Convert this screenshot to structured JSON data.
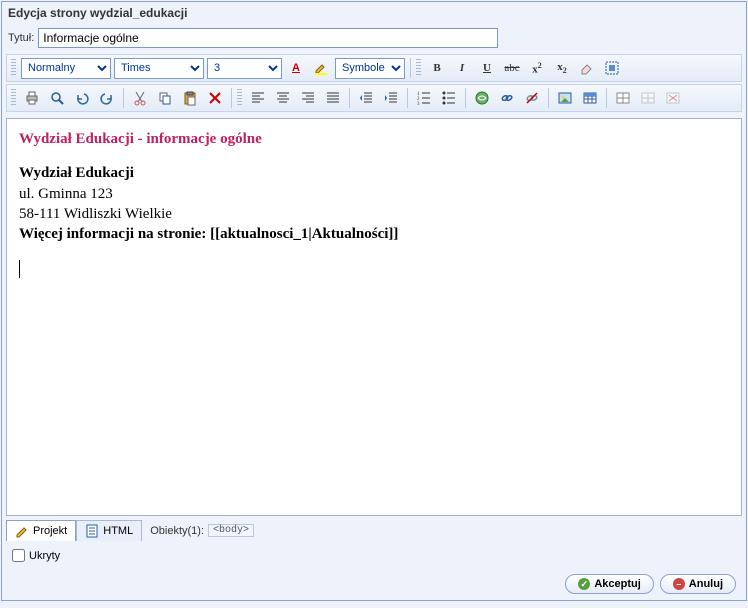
{
  "header": {
    "title": "Edycja strony wydzial_edukacji"
  },
  "titleRow": {
    "label": "Tytuł:",
    "value": "Informacje ogólne"
  },
  "toolbar1": {
    "styleSel": "Normalny",
    "fontSel": "Times",
    "sizeSel": "3",
    "symbolSel": "Symbole",
    "fontColorGlyph": "A",
    "bold": "B",
    "italic": "I",
    "underline": "U",
    "strike": "abc",
    "sup": "x²",
    "sub": "x₂"
  },
  "content": {
    "heading": "Wydział Edukacji - informacje ogólne",
    "line1": "Wydział Edukacji",
    "line2": "ul. Gminna 123",
    "line3": "58-111 Widliszki Wielkie",
    "line4a": "Więcej informacji na stronie: ",
    "line4b": "[[aktualnosci_1|Aktualności]]"
  },
  "tabs": {
    "projekt": "Projekt",
    "html": "HTML",
    "objects": "Obiekty(1):",
    "objToken": "<body>"
  },
  "hidden": {
    "label": "Ukryty"
  },
  "buttons": {
    "accept": "Akceptuj",
    "cancel": "Anuluj"
  }
}
